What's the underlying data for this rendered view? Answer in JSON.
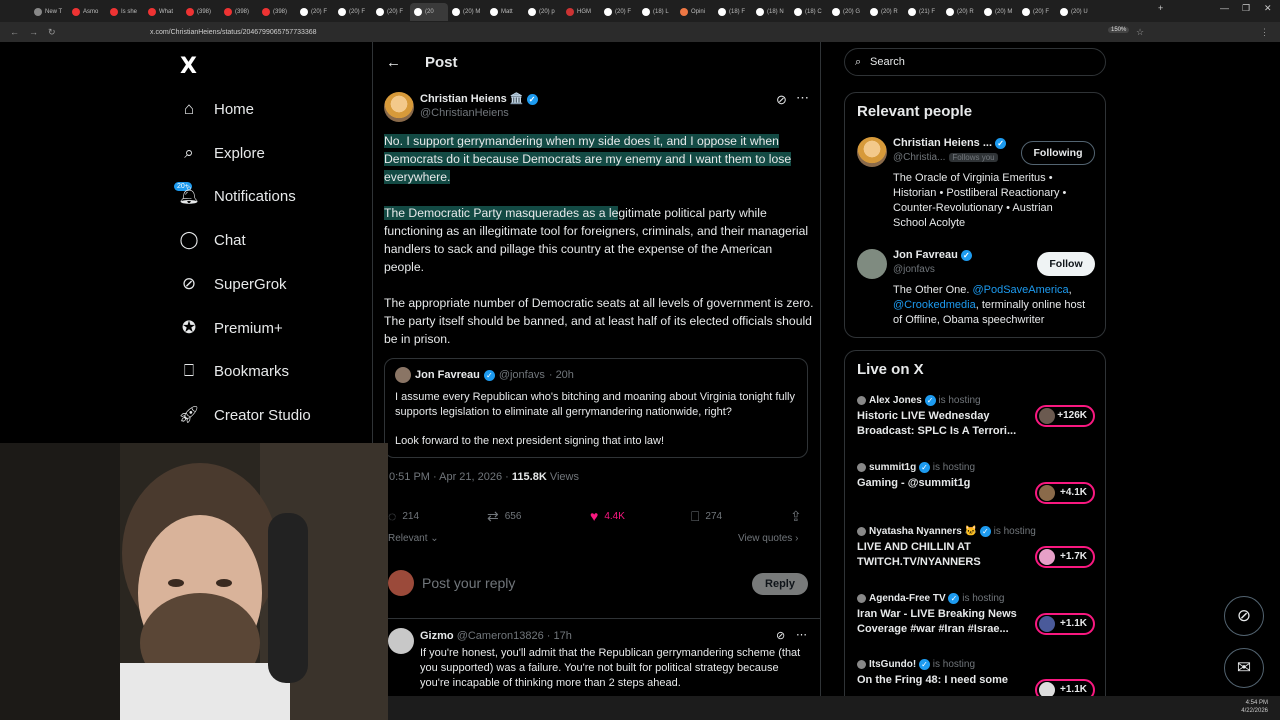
{
  "browser": {
    "tabs": [
      "New T",
      "Asmo",
      "Is she",
      "What",
      "(398)",
      "(398)",
      "(398)",
      "(20) F",
      "(20) F",
      "(20) F",
      "(20",
      "(20) M",
      "Matt",
      "(20) p",
      "HGM",
      "(20) F",
      "(18) L",
      "Opini",
      "(18) F",
      "(18) N",
      "(18) C",
      "(20) G",
      "(20) R",
      "(21) F",
      "(20) R",
      "(20) M",
      "(20) F",
      "(20) U"
    ],
    "url": "x.com/ChristianHeiens/status/2046799065757733368",
    "zoom": "150%"
  },
  "sidebar": {
    "logo": "X",
    "badge": "20+",
    "items": [
      {
        "label": "Home",
        "icon": "home-icon"
      },
      {
        "label": "Explore",
        "icon": "search-icon"
      },
      {
        "label": "Notifications",
        "icon": "bell-icon"
      },
      {
        "label": "Chat",
        "icon": "chat-icon"
      },
      {
        "label": "SuperGrok",
        "icon": "grok-icon"
      },
      {
        "label": "Premium+",
        "icon": "premium-icon"
      },
      {
        "label": "Bookmarks",
        "icon": "bookmark-icon"
      },
      {
        "label": "Creator Studio",
        "icon": "rocket-icon"
      }
    ]
  },
  "post": {
    "header": "Post",
    "author_name": "Christian Heiens 🏛️",
    "author_handle": "@ChristianHeiens",
    "para1": "No. I support gerrymandering when my side does it, and I oppose it when Democrats do it because Democrats are my enemy and I want them to lose everywhere.",
    "para2_highlight": "The Democratic Party masquerades as a le",
    "para2_rest": "gitimate political party while functioning as an illegitimate tool for foreigners, criminals, and their managerial handlers to sack and pillage this country at the expense of the American people.",
    "para3": "The appropriate number of Democratic seats at all levels of government is zero. The party itself should be banned, and at least half of its elected officials should be in prison.",
    "quote": {
      "name": "Jon Favreau",
      "handle": "@jonfavs",
      "time": "· 20h",
      "text1": "I assume every Republican who's bitching and moaning about Virginia tonight fully supports legislation to eliminate all gerrymandering nationwide, right?",
      "text2": "Look forward to the next president signing that into law!"
    },
    "timestamp": "0:51 PM · Apr 21, 2026 · ",
    "views_count": "115.8K",
    "views_label": " Views",
    "replies": "214",
    "reposts": "656",
    "likes": "4.4K",
    "bookmarks": "274",
    "sort_label": "Relevant",
    "view_quotes": "View quotes",
    "reply_placeholder": "Post your reply",
    "reply_button": "Reply"
  },
  "reply": {
    "name": "Gizmo",
    "handle": "@Cameron13826 · 17h",
    "text": "If you're honest, you'll admit that the Republican gerrymandering scheme (that you supported) was a failure. You're not built for political strategy because you're incapable of thinking more than 2 steps ahead."
  },
  "right": {
    "search_placeholder": "Search",
    "relevant_title": "Relevant people",
    "people": [
      {
        "name": "Christian Heiens ...",
        "handle": "@Christia...",
        "follows_you": "Follows you",
        "button": "Following",
        "bio": "The Oracle of Virginia Emeritus • Historian • Postliberal Reactionary • Counter-Revolutionary • Austrian School Acolyte"
      },
      {
        "name": "Jon Favreau",
        "handle": "@jonfavs",
        "button": "Follow",
        "bio_pre": "The Other One. ",
        "bio_link1": "@PodSaveAmerica",
        "bio_mid": ", ",
        "bio_link2": "@Crookedmedia",
        "bio_post": ", terminally online host of Offline, Obama speechwriter"
      }
    ],
    "live_title": "Live on X",
    "live": [
      {
        "host": "Alex Jones",
        "status": "is hosting",
        "title": "Historic LIVE Wednesday Broadcast: SPLC Is A Terrori...",
        "count": "+126K"
      },
      {
        "host": "summit1g",
        "status": "is hosting",
        "title": "Gaming - @summit1g",
        "count": "+4.1K"
      },
      {
        "host": "Nyatasha Nyanners 🐱",
        "status": "is hosting",
        "title": "LIVE AND CHILLIN AT TWITCH.TV/NYANNERS",
        "count": "+1.7K"
      },
      {
        "host": "Agenda-Free TV",
        "status": "is hosting",
        "title": "Iran War - LIVE Breaking News Coverage #war #Iran #Israe...",
        "count": "+1.1K"
      },
      {
        "host": "ItsGundo!",
        "status": "is hosting",
        "title": "On the Fring 48: I need some",
        "count": "+1.1K"
      }
    ]
  },
  "taskbar": {
    "time": "4:54 PM",
    "date": "4/22/2026"
  }
}
